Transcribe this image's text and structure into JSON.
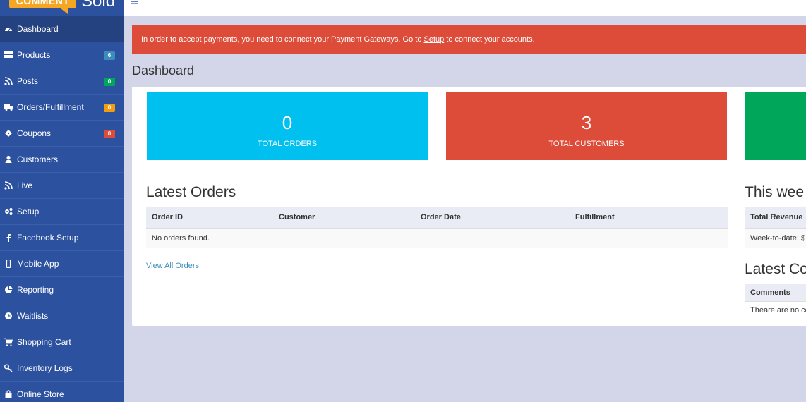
{
  "brand": {
    "badge": "COMMENT",
    "word": "Sold",
    "badge_color": "#f5a623"
  },
  "sidebar": {
    "items": [
      {
        "label": "Dashboard",
        "icon": "dashboard-icon",
        "active": true
      },
      {
        "label": "Products",
        "icon": "grid-icon",
        "badge": "6",
        "badge_color": "#3c8dbc"
      },
      {
        "label": "Posts",
        "icon": "rss-icon",
        "badge": "0",
        "badge_color": "#00a65a"
      },
      {
        "label": "Orders/Fulfillment",
        "icon": "truck-icon",
        "badge": "0",
        "badge_color": "#f39c12"
      },
      {
        "label": "Coupons",
        "icon": "ticket-icon",
        "badge": "0",
        "badge_color": "#dd4b39"
      },
      {
        "label": "Customers",
        "icon": "user-icon"
      },
      {
        "label": "Live",
        "icon": "rss-icon"
      },
      {
        "label": "Setup",
        "icon": "gears-icon"
      },
      {
        "label": "Facebook Setup",
        "icon": "facebook-icon"
      },
      {
        "label": "Mobile App",
        "icon": "mobile-icon"
      },
      {
        "label": "Reporting",
        "icon": "pie-chart-icon"
      },
      {
        "label": "Waitlists",
        "icon": "clock-icon"
      },
      {
        "label": "Shopping Cart",
        "icon": "cart-icon"
      },
      {
        "label": "Inventory Logs",
        "icon": "key-icon"
      },
      {
        "label": "Online Store",
        "icon": "bag-icon"
      }
    ]
  },
  "alert": {
    "text_before": "In order to accept payments, you need to connect your Payment Gateways. Go to ",
    "link": "Setup",
    "text_after": " to connect your accounts.",
    "color": "#dd4b39"
  },
  "page_title": "Dashboard",
  "stats": [
    {
      "value": "0",
      "label": "TOTAL ORDERS",
      "color": "#00c0ef"
    },
    {
      "value": "3",
      "label": "TOTAL CUSTOMERS",
      "color": "#dd4b39"
    },
    {
      "value": "",
      "label": "",
      "color": "#00a65a"
    }
  ],
  "latest_orders": {
    "title": "Latest Orders",
    "columns": [
      "Order ID",
      "Customer",
      "Order Date",
      "Fulfillment"
    ],
    "empty": "No orders found.",
    "view_all": "View All Orders"
  },
  "this_week": {
    "title": "This wee",
    "header": "Total Revenue",
    "row": "Week-to-date: $"
  },
  "latest_comments": {
    "title": "Latest Co",
    "header": "Comments",
    "row": "Theare are no co"
  }
}
